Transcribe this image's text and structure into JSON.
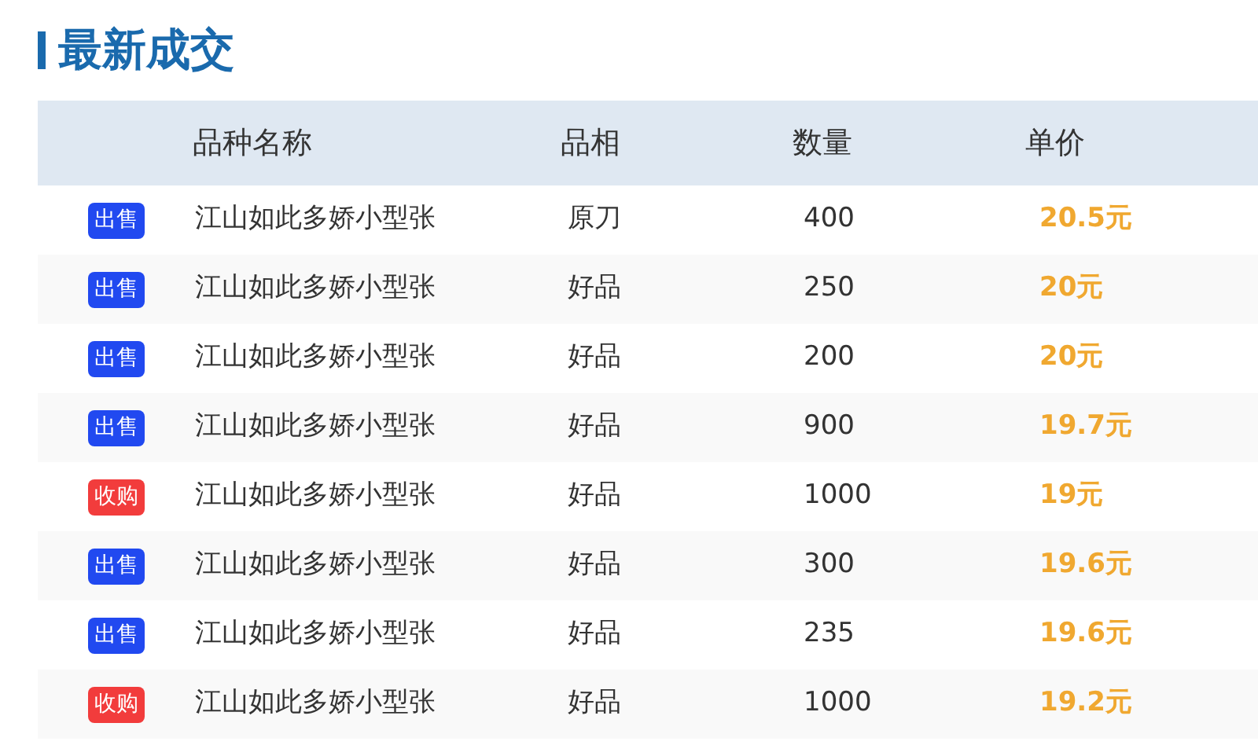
{
  "title": "最新成交",
  "table": {
    "columns": [
      "品种名称",
      "品相",
      "数量",
      "单价"
    ],
    "rows": [
      {
        "tag": {
          "kind": "sell",
          "label": "出售"
        },
        "name": "江山如此多娇小型张",
        "grade": "原刀",
        "quantity": "400",
        "price": "20.5元"
      },
      {
        "tag": {
          "kind": "sell",
          "label": "出售"
        },
        "name": "江山如此多娇小型张",
        "grade": "好品",
        "quantity": "250",
        "price": "20元"
      },
      {
        "tag": {
          "kind": "sell",
          "label": "出售"
        },
        "name": "江山如此多娇小型张",
        "grade": "好品",
        "quantity": "200",
        "price": "20元"
      },
      {
        "tag": {
          "kind": "sell",
          "label": "出售"
        },
        "name": "江山如此多娇小型张",
        "grade": "好品",
        "quantity": "900",
        "price": "19.7元"
      },
      {
        "tag": {
          "kind": "buy",
          "label": "收购"
        },
        "name": "江山如此多娇小型张",
        "grade": "好品",
        "quantity": "1000",
        "price": "19元"
      },
      {
        "tag": {
          "kind": "sell",
          "label": "出售"
        },
        "name": "江山如此多娇小型张",
        "grade": "好品",
        "quantity": "300",
        "price": "19.6元"
      },
      {
        "tag": {
          "kind": "sell",
          "label": "出售"
        },
        "name": "江山如此多娇小型张",
        "grade": "好品",
        "quantity": "235",
        "price": "19.6元"
      },
      {
        "tag": {
          "kind": "buy",
          "label": "收购"
        },
        "name": "江山如此多娇小型张",
        "grade": "好品",
        "quantity": "1000",
        "price": "19.2元"
      }
    ]
  }
}
